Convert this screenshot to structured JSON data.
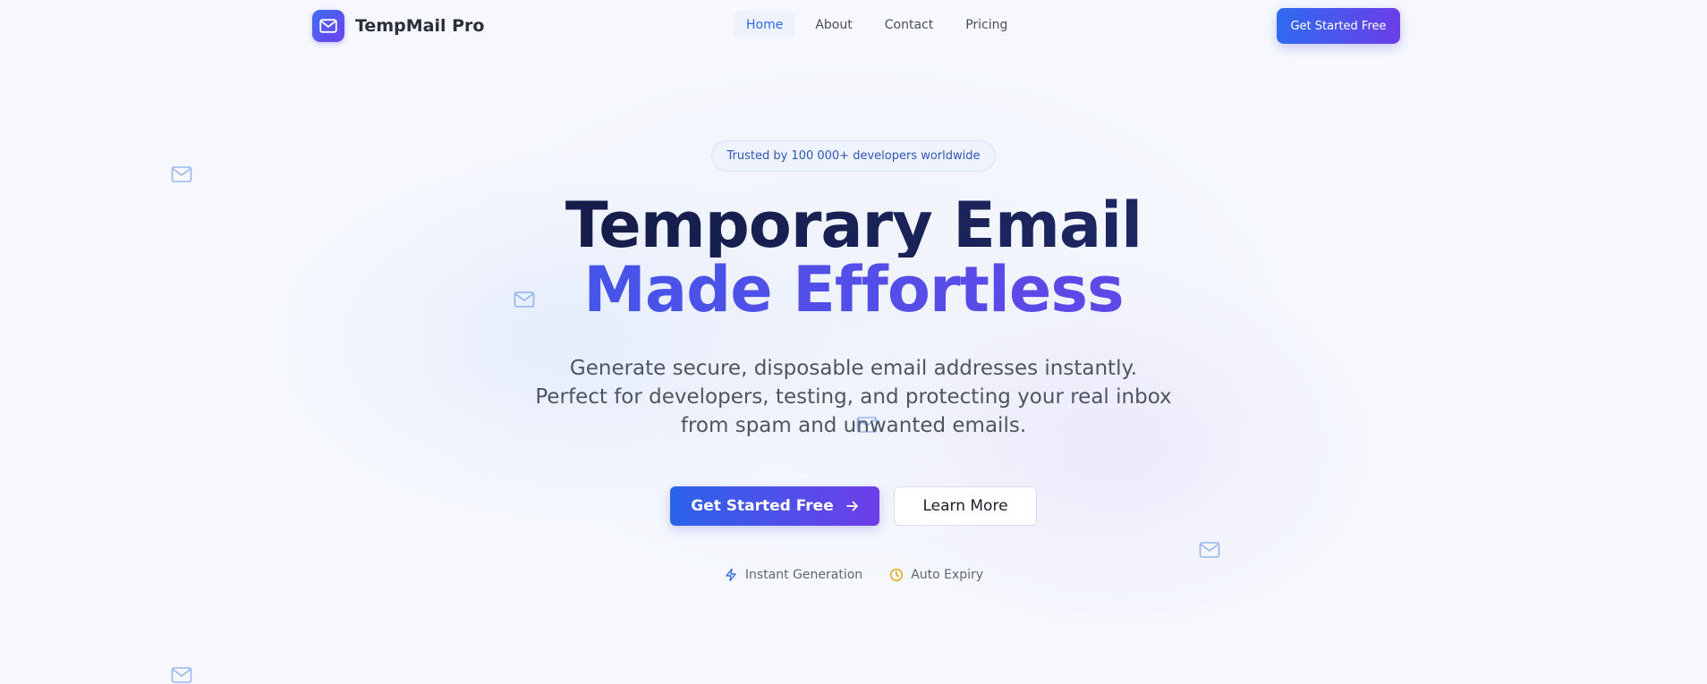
{
  "header": {
    "brand": "TempMail Pro",
    "nav": [
      {
        "label": "Home",
        "active": true
      },
      {
        "label": "About",
        "active": false
      },
      {
        "label": "Contact",
        "active": false
      },
      {
        "label": "Pricing",
        "active": false
      }
    ],
    "cta_label": "Get Started Free"
  },
  "hero": {
    "trust_badge": "Trusted by 100 000+ developers worldwide",
    "headline_line1": "Temporary Email",
    "headline_line2": "Made Effortless",
    "subtitle": "Generate secure, disposable email addresses instantly. Perfect for developers, testing, and protecting your real inbox from spam and unwanted emails.",
    "primary_button": "Get Started Free",
    "secondary_button": "Learn More",
    "features": [
      {
        "label": "Instant Generation",
        "icon": "lightning-icon",
        "color": "#3b6fe0"
      },
      {
        "label": "Auto Expiry",
        "icon": "clock-icon",
        "color": "#e8a21a"
      }
    ]
  },
  "theme": {
    "accent_blue": "#2b63ea",
    "accent_purple": "#7b39e6",
    "background": "#f6f8fd"
  },
  "decor": {
    "floating_icon": "envelope-icon"
  }
}
